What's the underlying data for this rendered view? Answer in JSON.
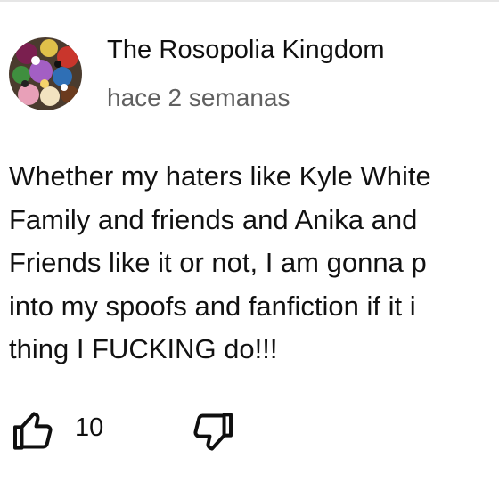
{
  "comment": {
    "author": "The Rosopolia Kingdom",
    "timestamp": "hace 2 semanas",
    "text_lines": [
      "Whether my haters like Kyle White",
      "Family and friends and Anika and",
      "Friends like it or not, I am gonna p",
      "into my spoofs and fanfiction if it i",
      "thing I FUCKING do!!!"
    ],
    "like_count": "10"
  },
  "icons": {
    "avatar": "avatar-image",
    "like": "thumbs-up-icon",
    "dislike": "thumbs-down-icon"
  }
}
